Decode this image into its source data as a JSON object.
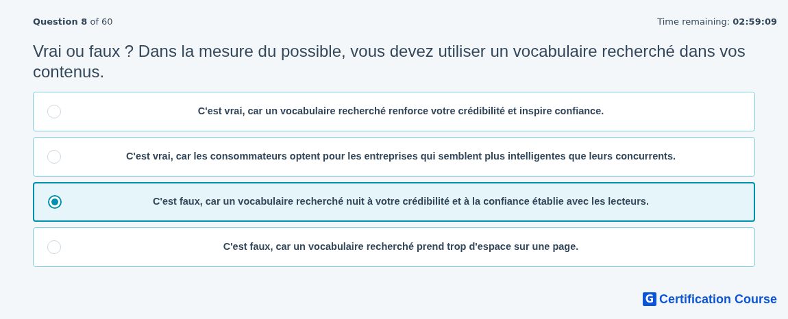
{
  "header": {
    "progress": "**Question 8** of 60",
    "timer": "Time remaining: **02:59:09**"
  },
  "question": "Vrai ou faux ? Dans la mesure du possible, vous devez utiliser un vocabulaire recherché dans vos contenus.",
  "options": [
    {
      "label": "C'est vrai, car un vocabulaire recherché renforce votre crédibilité et inspire confiance.",
      "selected": false
    },
    {
      "label": "C'est vrai, car les consommateurs optent pour les entreprises qui semblent plus intelligentes que leurs concurrents.",
      "selected": false
    },
    {
      "label": "C'est faux, car un vocabulaire recherché nuit à votre crédibilité et à la confiance établie avec les lecteurs.",
      "selected": true
    },
    {
      "label": "C'est faux, car un vocabulaire recherché prend trop d'espace sur une page.",
      "selected": false
    }
  ],
  "brand": {
    "mark": "G",
    "name": "Certification Course"
  }
}
